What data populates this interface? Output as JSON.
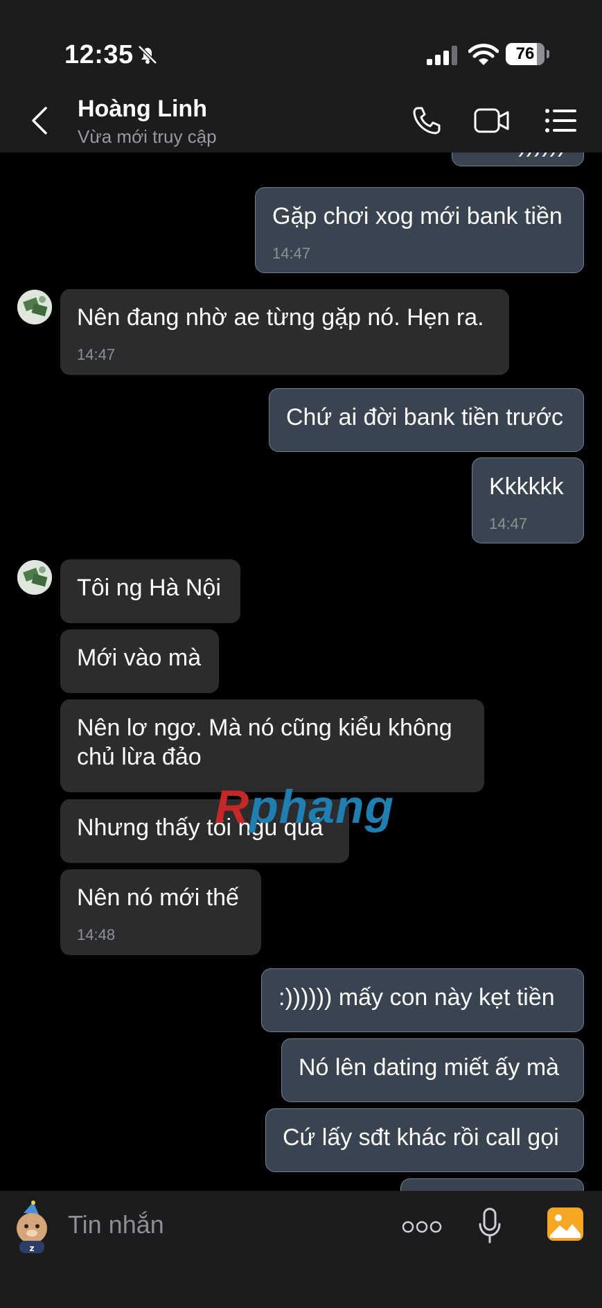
{
  "status_bar": {
    "time": "12:35",
    "battery": "76"
  },
  "header": {
    "contact_name": "Hoàng Linh",
    "status": "Vừa mới truy cập"
  },
  "messages": [
    {
      "from": "me",
      "text": "Với :))))))",
      "partial": true
    },
    {
      "from": "me",
      "text": "Gặp chơi xog mới bank tiền",
      "time": "14:47"
    },
    {
      "from": "them",
      "text": "Nên đang nhờ ae từng gặp nó. Hẹn ra.",
      "time": "14:47"
    },
    {
      "from": "me",
      "text": "Chứ ai đời bank tiền trước"
    },
    {
      "from": "me",
      "text": "Kkkkkk",
      "time": "14:47"
    },
    {
      "from": "them",
      "text": "Tôi ng Hà Nội"
    },
    {
      "from": "them",
      "text": "Mới vào mà"
    },
    {
      "from": "them",
      "text_lines": [
        "Nên lơ ngơ. Mà nó cũng kiểu không",
        "chủ lừa đảo"
      ]
    },
    {
      "from": "them",
      "text": "Nhưng thấy tôi ngu quá"
    },
    {
      "from": "them",
      "text": "Nên nó mới thế",
      "time": "14:48"
    },
    {
      "from": "me",
      "text": ":)))))) mấy con này kẹt tiền"
    },
    {
      "from": "me",
      "text": "Nó lên dating miết ấy mà"
    },
    {
      "from": "me",
      "text": "Cứ lấy sđt khác rồi call gọi"
    },
    {
      "from": "me",
      "text": "",
      "partial": true
    }
  ],
  "watermark": {
    "part1": "R",
    "part2": "phang"
  },
  "composer": {
    "placeholder": "Tin nhắn"
  },
  "icons": {
    "status": [
      "bell-off-icon",
      "signal-icon",
      "wifi-icon",
      "battery-icon"
    ],
    "header": [
      "back-chevron-icon",
      "phone-icon",
      "video-call-icon",
      "menu-list-icon"
    ],
    "composer": [
      "sticker-icon",
      "more-dots-icon",
      "microphone-icon",
      "image-gallery-icon"
    ]
  },
  "colors": {
    "my_bubble": "#3a4350",
    "my_bubble_border": "#6f8297",
    "their_bubble": "#2c2c2e",
    "accent_gallery": "#f5a623"
  }
}
